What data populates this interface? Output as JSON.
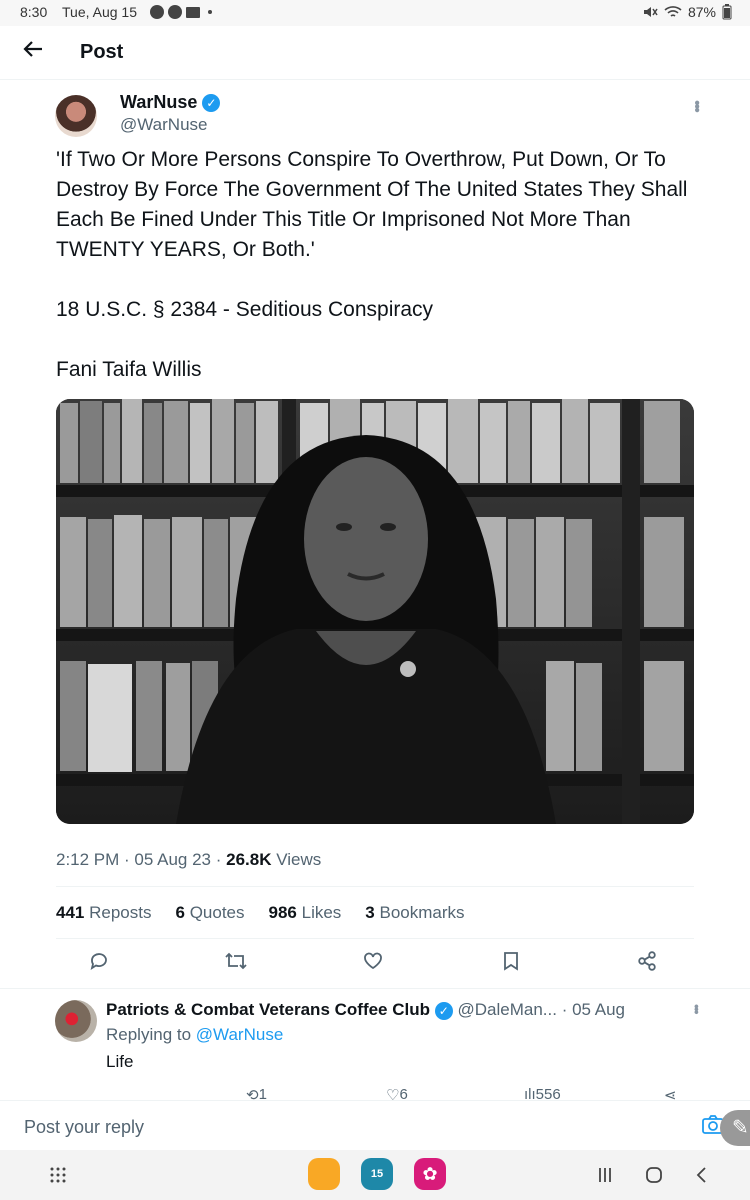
{
  "status_bar": {
    "time": "8:30",
    "date": "Tue, Aug 15",
    "battery": "87%"
  },
  "header": {
    "title": "Post"
  },
  "tweet": {
    "author_name": "WarNuse",
    "author_handle": "@WarNuse",
    "paragraphs": [
      "'If Two Or More Persons Conspire To Overthrow, Put Down, Or To Destroy By Force The Government Of The United States They Shall Each Be Fined Under This Title Or Imprisoned Not More Than TWENTY YEARS, Or Both.'",
      "18 U.S.C. § 2384 - Seditious Conspiracy",
      "Fani Taifa Willis"
    ],
    "time": "2:12 PM",
    "date": "05 Aug 23",
    "views_count": "26.8K",
    "views_label": "Views",
    "stats": {
      "reposts_count": "441",
      "reposts_label": "Reposts",
      "quotes_count": "6",
      "quotes_label": "Quotes",
      "likes_count": "986",
      "likes_label": "Likes",
      "bookmarks_count": "3",
      "bookmarks_label": "Bookmarks"
    }
  },
  "reply": {
    "name": "Patriots & Combat Veterans Coffee Club",
    "handle": "@DaleMan...",
    "date": "· 05 Aug",
    "replying_prefix": "Replying to",
    "replying_to": "@WarNuse",
    "text": "Life",
    "reposts": "1",
    "likes": "6",
    "views": "556"
  },
  "compose": {
    "placeholder": "Post your reply"
  },
  "navbar": {
    "calendar_day": "15"
  }
}
